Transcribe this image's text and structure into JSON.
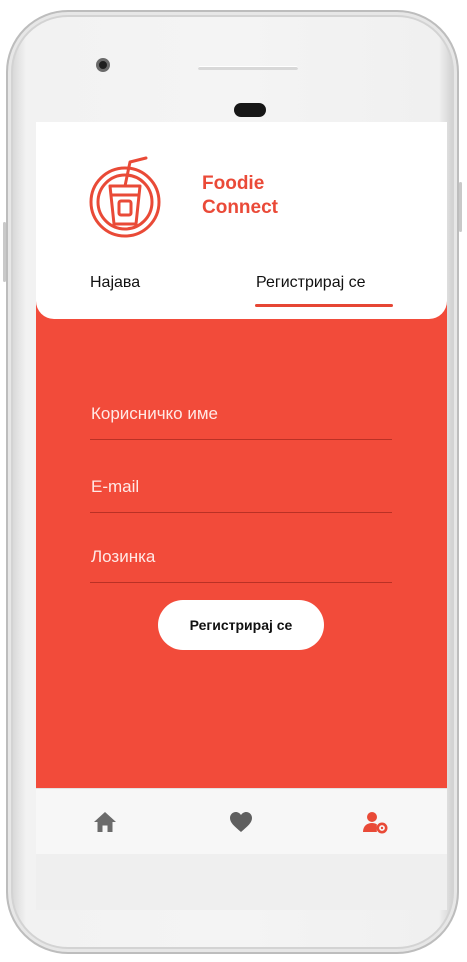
{
  "app": {
    "name_line1": "Foodie",
    "name_line2": "Connect",
    "logo_icon": "drink-cup-icon",
    "accent_color": "#f24b3a"
  },
  "tabs": {
    "login_label": "Најава",
    "register_label": "Регистрирај се",
    "active": "register"
  },
  "form": {
    "username_placeholder": "Корисничко име",
    "email_placeholder": "E-mail",
    "password_placeholder": "Лозинка",
    "submit_label": "Регистрирај се"
  },
  "bottom_nav": {
    "items": [
      {
        "icon": "home-icon",
        "active": false
      },
      {
        "icon": "heart-icon",
        "active": false
      },
      {
        "icon": "user-settings-icon",
        "active": true
      }
    ]
  }
}
